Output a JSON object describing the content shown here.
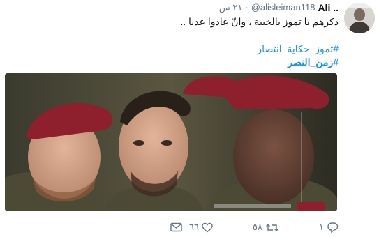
{
  "tweet": {
    "display_name": "Ali ..",
    "handle": "@alisleiman118",
    "separator": "·",
    "timestamp": "٢١ س",
    "text": "ذكرهم يا تموز بالخيبة ، وانّ عادوا عدنا ..",
    "hashtags": [
      {
        "label": "#تموز_حكاية_انتصار"
      },
      {
        "label": "#زمن_النصر"
      }
    ],
    "actions": {
      "reply_count": "١",
      "retweet_count": "٥٨",
      "like_count": "٦٦"
    }
  },
  "icons": {
    "reply": "reply-icon",
    "retweet": "retweet-icon",
    "like": "heart-icon",
    "dm": "envelope-icon"
  },
  "colors": {
    "link": "#1b95e0",
    "muted": "#657786",
    "text": "#14171a",
    "beret": "#8e1f2c",
    "uniform": "#4c4a35"
  }
}
